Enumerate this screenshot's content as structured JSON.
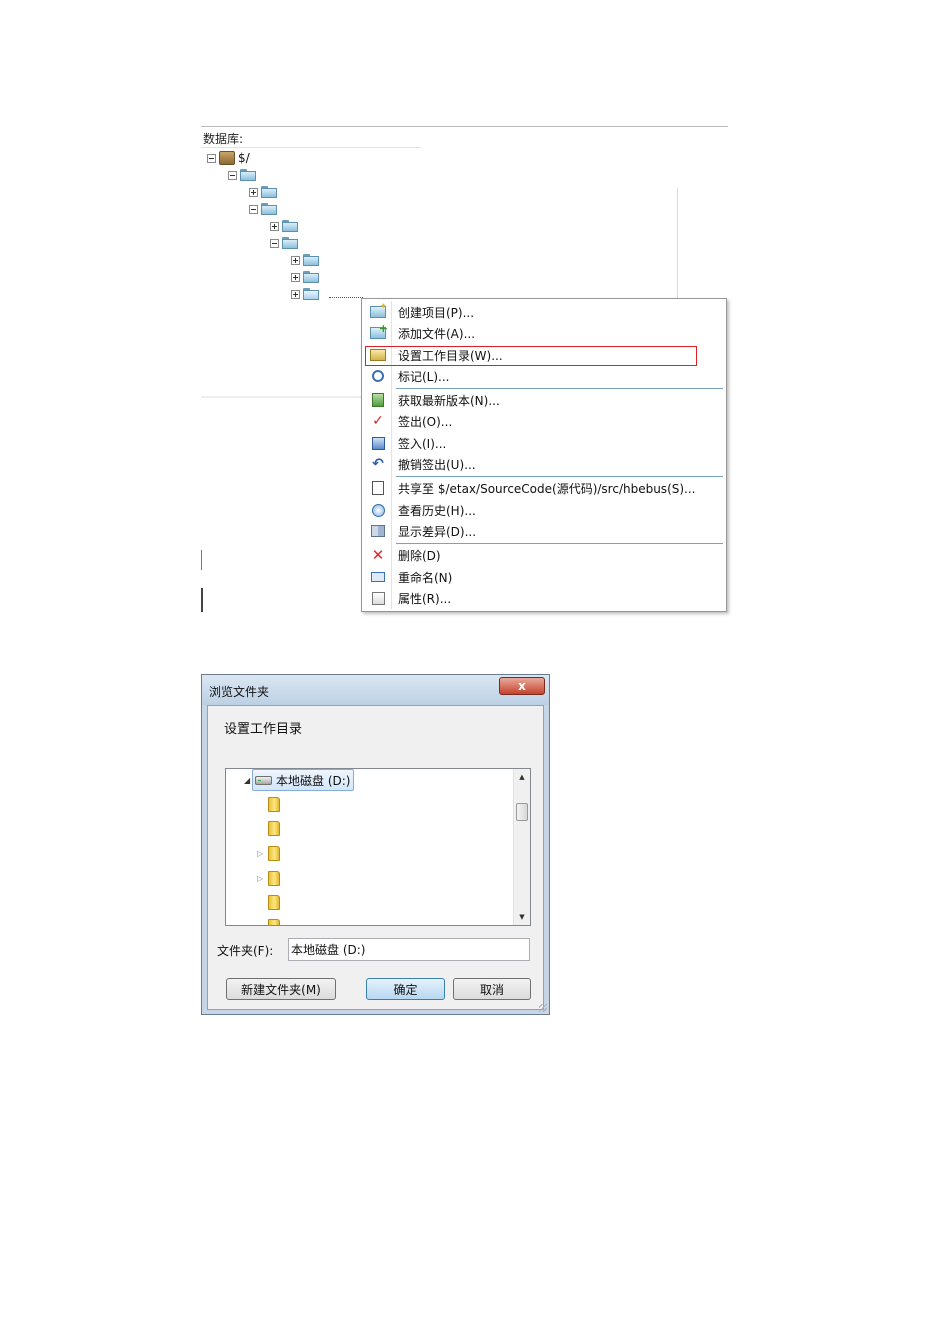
{
  "repository_panel": {
    "header": "数据库:",
    "root_label": "$/"
  },
  "context_menu": {
    "items": [
      {
        "label": "创建项目(P)...",
        "icon": "create-project-icon"
      },
      {
        "label": "添加文件(A)...",
        "icon": "add-file-icon"
      },
      {
        "label": "设置工作目录(W)...",
        "icon": "set-working-folder-icon",
        "highlighted": true
      },
      {
        "label": "标记(L)...",
        "icon": "label-icon"
      },
      {
        "label": "获取最新版本(N)...",
        "icon": "get-latest-icon"
      },
      {
        "label": "签出(O)...",
        "icon": "check-out-icon"
      },
      {
        "label": "签入(I)...",
        "icon": "check-in-icon"
      },
      {
        "label": "撤销签出(U)...",
        "icon": "undo-checkout-icon"
      },
      {
        "label": "共享至 $/etax/SourceCode(源代码)/src/hbebus(S)...",
        "icon": "share-icon"
      },
      {
        "label": "查看历史(H)...",
        "icon": "history-icon"
      },
      {
        "label": "显示差异(D)...",
        "icon": "diff-icon"
      },
      {
        "label": "删除(D)",
        "icon": "delete-icon"
      },
      {
        "label": "重命名(N)",
        "icon": "rename-icon"
      },
      {
        "label": "属性(R)...",
        "icon": "properties-icon"
      }
    ],
    "highlight_color": "#dd2222"
  },
  "browse_dialog": {
    "title": "浏览文件夹",
    "close_label": "x",
    "description": "设置工作目录",
    "tree": {
      "drive_label": "本地磁盘 (D:)"
    },
    "folder_field": {
      "label": "文件夹(F):",
      "value": "本地磁盘 (D:)"
    },
    "buttons": {
      "new_folder": "新建文件夹(M)",
      "ok": "确定",
      "cancel": "取消"
    }
  }
}
